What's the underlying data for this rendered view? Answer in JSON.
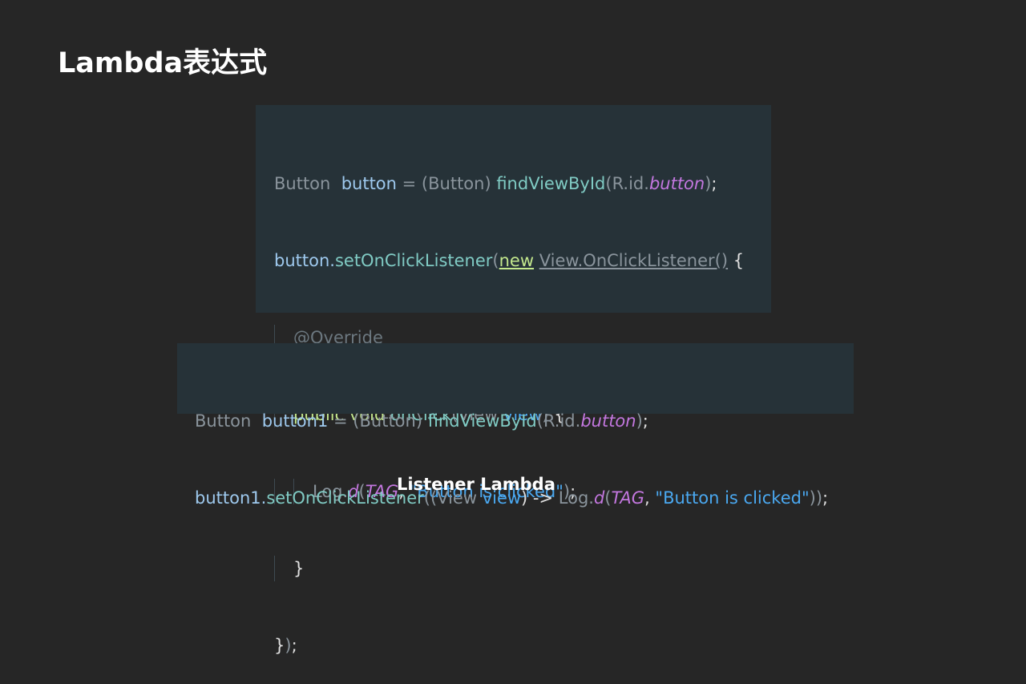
{
  "title": "Lambda表达式",
  "caption": "Listener Lambda",
  "code_block_1": {
    "lines": [
      [
        "Button",
        "  ",
        "button",
        " = ",
        "(Button) ",
        "findViewById",
        "(R.id.",
        "button",
        ")",
        ";"
      ],
      [
        "button.",
        "setOnClickListener",
        "(",
        "new",
        " ",
        "View.OnClickListener()",
        " {"
      ],
      [
        "@Override"
      ],
      [
        "public void",
        " ",
        "onClick",
        "(View ",
        "view",
        ")",
        " {"
      ],
      [
        "Log.",
        "d",
        "(",
        "TAG",
        ", ",
        "\"Button is clicked\"",
        ")",
        ";"
      ],
      [
        "}"
      ],
      [
        "}",
        ")",
        ";"
      ]
    ]
  },
  "code_block_2": {
    "lines": [
      [
        "Button",
        "  ",
        "button1",
        " = ",
        "(Button) ",
        "findViewById",
        "(R.id.",
        "button",
        ")",
        ";"
      ],
      [
        "button1.",
        "setOnClickListener",
        "((View ",
        "view",
        ") -> ",
        "Log.",
        "d",
        "(",
        "TAG",
        ", ",
        "\"Button is clicked\"",
        "))",
        ";"
      ]
    ]
  }
}
